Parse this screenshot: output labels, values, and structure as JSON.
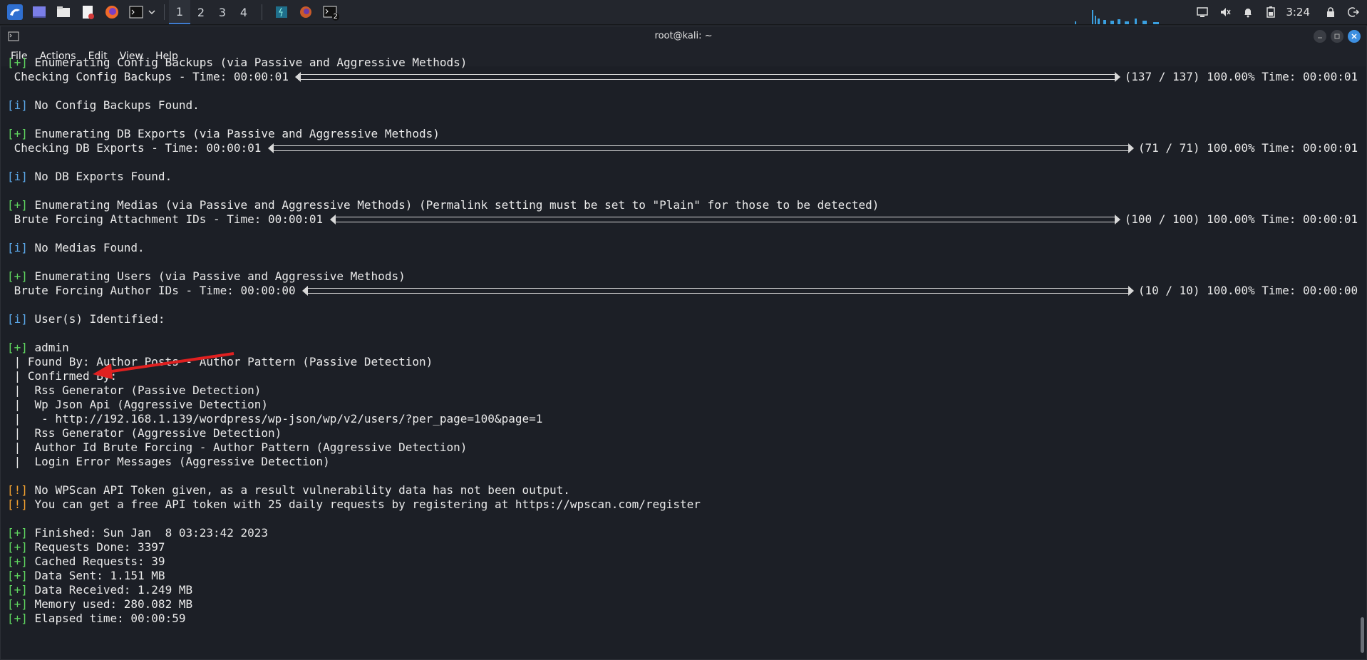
{
  "taskbar": {
    "workspaces": [
      "1",
      "2",
      "3",
      "4"
    ],
    "active_workspace": "1",
    "clock": "3:24",
    "icons": [
      "kali-menu-icon",
      "desktop-icon",
      "file-manager-icon",
      "text-editor-icon",
      "firefox-icon",
      "terminal-icon",
      "dropdown-icon"
    ],
    "badge": "2"
  },
  "window": {
    "title": "root@kali: ~",
    "menu": [
      "File",
      "Actions",
      "Edit",
      "View",
      "Help"
    ]
  },
  "terminal": {
    "lines": [
      {
        "tag": "[+]",
        "tag_color": "green",
        "text": " Enumerating Config Backups (via Passive and Aggressive Methods)"
      },
      {
        "tag": "",
        "text": " Checking Config Backups - Time: 00:00:01 ",
        "progress_tail": "(137 / 137) 100.00% Time: 00:00:01"
      },
      {
        "tag": "",
        "text": ""
      },
      {
        "tag": "[i]",
        "tag_color": "blue",
        "text": " No Config Backups Found."
      },
      {
        "tag": "",
        "text": ""
      },
      {
        "tag": "[+]",
        "tag_color": "green",
        "text": " Enumerating DB Exports (via Passive and Aggressive Methods)"
      },
      {
        "tag": "",
        "text": " Checking DB Exports - Time: 00:00:01 ",
        "progress_tail": "(71 / 71) 100.00% Time: 00:00:01"
      },
      {
        "tag": "",
        "text": ""
      },
      {
        "tag": "[i]",
        "tag_color": "blue",
        "text": " No DB Exports Found."
      },
      {
        "tag": "",
        "text": ""
      },
      {
        "tag": "[+]",
        "tag_color": "green",
        "text": " Enumerating Medias (via Passive and Aggressive Methods) (Permalink setting must be set to \"Plain\" for those to be detected)"
      },
      {
        "tag": "",
        "text": " Brute Forcing Attachment IDs - Time: 00:00:01 ",
        "progress_tail": "(100 / 100) 100.00% Time: 00:00:01"
      },
      {
        "tag": "",
        "text": ""
      },
      {
        "tag": "[i]",
        "tag_color": "blue",
        "text": " No Medias Found."
      },
      {
        "tag": "",
        "text": ""
      },
      {
        "tag": "[+]",
        "tag_color": "green",
        "text": " Enumerating Users (via Passive and Aggressive Methods)"
      },
      {
        "tag": "",
        "text": " Brute Forcing Author IDs - Time: 00:00:00 ",
        "progress_tail": "(10 / 10) 100.00% Time: 00:00:00"
      },
      {
        "tag": "",
        "text": ""
      },
      {
        "tag": "[i]",
        "tag_color": "blue",
        "text": " User(s) Identified:"
      },
      {
        "tag": "",
        "text": ""
      },
      {
        "tag": "[+]",
        "tag_color": "green",
        "text": " admin"
      },
      {
        "tag": "",
        "text": " | Found By: Author Posts - Author Pattern (Passive Detection)"
      },
      {
        "tag": "",
        "text": " | Confirmed By:"
      },
      {
        "tag": "",
        "text": " |  Rss Generator (Passive Detection)"
      },
      {
        "tag": "",
        "text": " |  Wp Json Api (Aggressive Detection)"
      },
      {
        "tag": "",
        "text": " |   - http://192.168.1.139/wordpress/wp-json/wp/v2/users/?per_page=100&page=1"
      },
      {
        "tag": "",
        "text": " |  Rss Generator (Aggressive Detection)"
      },
      {
        "tag": "",
        "text": " |  Author Id Brute Forcing - Author Pattern (Aggressive Detection)"
      },
      {
        "tag": "",
        "text": " |  Login Error Messages (Aggressive Detection)"
      },
      {
        "tag": "",
        "text": ""
      },
      {
        "tag": "[!]",
        "tag_color": "orange",
        "text": " No WPScan API Token given, as a result vulnerability data has not been output."
      },
      {
        "tag": "[!]",
        "tag_color": "orange",
        "text": " You can get a free API token with 25 daily requests by registering at https://wpscan.com/register"
      },
      {
        "tag": "",
        "text": ""
      },
      {
        "tag": "[+]",
        "tag_color": "green",
        "text": " Finished: Sun Jan  8 03:23:42 2023"
      },
      {
        "tag": "[+]",
        "tag_color": "green",
        "text": " Requests Done: 3397"
      },
      {
        "tag": "[+]",
        "tag_color": "green",
        "text": " Cached Requests: 39"
      },
      {
        "tag": "[+]",
        "tag_color": "green",
        "text": " Data Sent: 1.151 MB"
      },
      {
        "tag": "[+]",
        "tag_color": "green",
        "text": " Data Received: 1.249 MB"
      },
      {
        "tag": "[+]",
        "tag_color": "green",
        "text": " Memory used: 280.082 MB"
      },
      {
        "tag": "[+]",
        "tag_color": "green",
        "text": " Elapsed time: 00:00:59"
      }
    ]
  },
  "colors": {
    "green": "#5fd35f",
    "blue": "#5aa6e6",
    "orange": "#f0a030",
    "arrow": "#e02020"
  }
}
